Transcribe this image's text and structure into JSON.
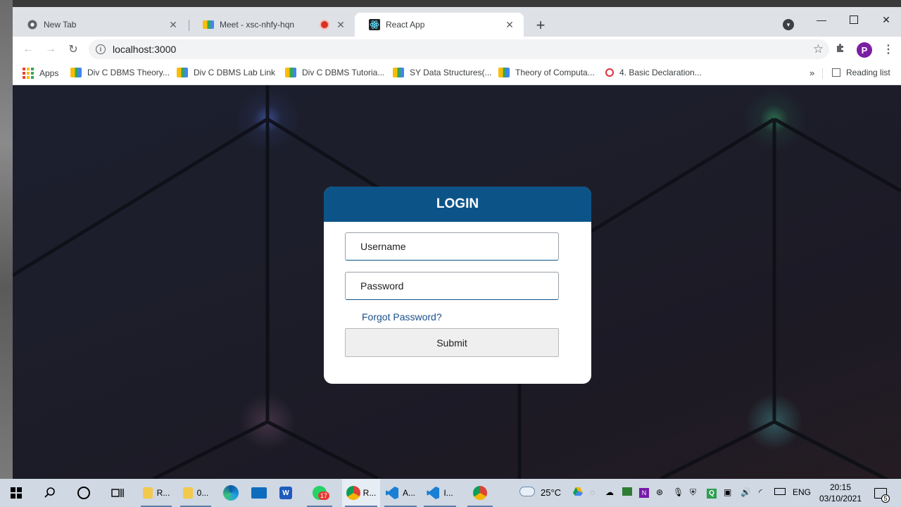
{
  "browser": {
    "tabs": [
      {
        "title": "New Tab",
        "icon": "chrome-icon"
      },
      {
        "title": "Meet - xsc-nhfy-hqn",
        "icon": "google-meet-icon",
        "recording": true
      },
      {
        "title": "React App",
        "icon": "react-icon",
        "active": true
      }
    ],
    "address": "localhost:3000",
    "profile_initial": "P",
    "bookmarks": [
      {
        "label": "Apps",
        "icon": "apps-grid-icon"
      },
      {
        "label": "Div C DBMS Theory...",
        "icon": "google-meet-icon"
      },
      {
        "label": "Div C DBMS Lab Link",
        "icon": "google-meet-icon"
      },
      {
        "label": "Div C DBMS Tutoria...",
        "icon": "google-meet-icon"
      },
      {
        "label": "SY Data Structures(...",
        "icon": "google-meet-icon"
      },
      {
        "label": "Theory of Computa...",
        "icon": "google-meet-icon"
      },
      {
        "label": "4. Basic Declaration...",
        "icon": "opera-icon"
      }
    ],
    "reading_list": "Reading list"
  },
  "login": {
    "title": "LOGIN",
    "username_placeholder": "Username",
    "password_placeholder": "Password",
    "forgot_link": "Forgot Password?",
    "submit_label": "Submit"
  },
  "taskbar": {
    "apps": [
      {
        "label": "R...",
        "icon": "file-explorer-icon"
      },
      {
        "label": "0...",
        "icon": "file-explorer-icon"
      },
      {
        "label": "",
        "icon": "edge-icon"
      },
      {
        "label": "",
        "icon": "mail-icon"
      },
      {
        "label": "",
        "icon": "word-icon"
      },
      {
        "label": "",
        "icon": "whatsapp-icon",
        "badge": "17"
      },
      {
        "label": "R...",
        "icon": "chrome-icon"
      },
      {
        "label": "A...",
        "icon": "vscode-icon"
      },
      {
        "label": "I...",
        "icon": "vscode-icon"
      },
      {
        "label": "",
        "icon": "chrome-icon"
      }
    ],
    "weather": "25°C",
    "language": "ENG",
    "time": "20:15",
    "date": "03/10/2021",
    "notifications": "5"
  },
  "colors": {
    "login_header": "#0c5488",
    "forgot_link": "#1a4f8b",
    "profile": "#7b1fa2"
  }
}
